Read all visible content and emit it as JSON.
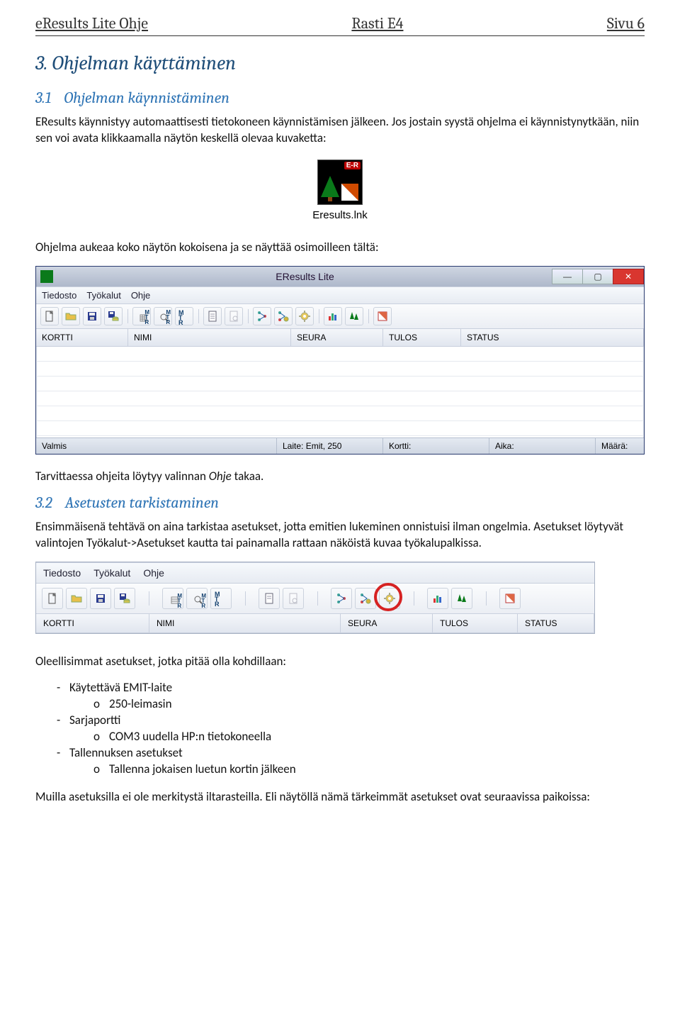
{
  "header": {
    "left": "eResults Lite Ohje",
    "center": "Rasti E4",
    "right": "Sivu 6"
  },
  "sections": {
    "s3": {
      "num": "3.",
      "title": "Ohjelman käyttäminen"
    },
    "s31": {
      "num": "3.1",
      "title": "Ohjelman käynnistäminen"
    },
    "s32": {
      "num": "3.2",
      "title": "Asetusten tarkistaminen"
    }
  },
  "text": {
    "p1": "EResults käynnistyy automaattisesti tietokoneen käynnistämisen jälkeen. Jos jostain syystä ohjelma ei käynnistynytkään, niin sen voi avata klikkaamalla näytön keskellä olevaa kuvaketta:",
    "iconCaption": "Eresults.lnk",
    "p2": "Ohjelma aukeaa koko näytön kokoisena ja se näyttää osimoilleen tältä:",
    "p3a": "Tarvittaessa ohjeita löytyy valinnan ",
    "p3b": "Ohje",
    "p3c": " takaa.",
    "p4": "Ensimmäisenä tehtävä on aina tarkistaa asetukset, jotta emitien lukeminen onnistuisi ilman ongelmia. Asetukset löytyvät valintojen Työkalut->Asetukset kautta tai painamalla rattaan näköistä kuvaa työkalupalkissa.",
    "p5": "Oleellisimmat asetukset, jotka pitää olla kohdillaan:",
    "list": {
      "l1": "Käytettävä EMIT-laite",
      "l1a": "250-leimasin",
      "l2": "Sarjaportti",
      "l2a": "COM3 uudella HP:n tietokoneella",
      "l3": "Tallennuksen asetukset",
      "l3a": "Tallenna jokaisen luetun kortin jälkeen"
    },
    "p6": "Muilla asetuksilla ei ole merkitystä iltarasteilla. Eli näytöllä nämä tärkeimmät asetukset ovat seuraavissa paikoissa:"
  },
  "app": {
    "title": "EResults Lite",
    "menu": [
      "Tiedosto",
      "Työkalut",
      "Ohje"
    ],
    "columns": {
      "kortti": "KORTTI",
      "nimi": "NIMI",
      "seura": "SEURA",
      "tulos": "TULOS",
      "status": "STATUS"
    },
    "status": {
      "valmis": "Valmis",
      "laite": "Laite: Emit, 250",
      "kortti": "Kortti:",
      "aika": "Aika:",
      "maara": "Määrä:"
    },
    "btn": {
      "min": "—",
      "max": "▢",
      "close": "✕"
    }
  },
  "icons": {
    "new": "new-doc-icon",
    "open": "open-folder-icon",
    "save": "save-icon",
    "savedb": "save-db-icon",
    "mtr_grid": "mtr-grid-icon",
    "mtr_search": "mtr-search-icon",
    "mtr_plain": "mtr-icon",
    "doc_a": "report-icon",
    "doc_b": "preview-icon",
    "structure": "structure-icon",
    "fork": "fork-settings-icon",
    "gear": "settings-gear-icon",
    "chart": "results-chart-icon",
    "trees": "forest-icon",
    "flag": "flag-icon"
  }
}
